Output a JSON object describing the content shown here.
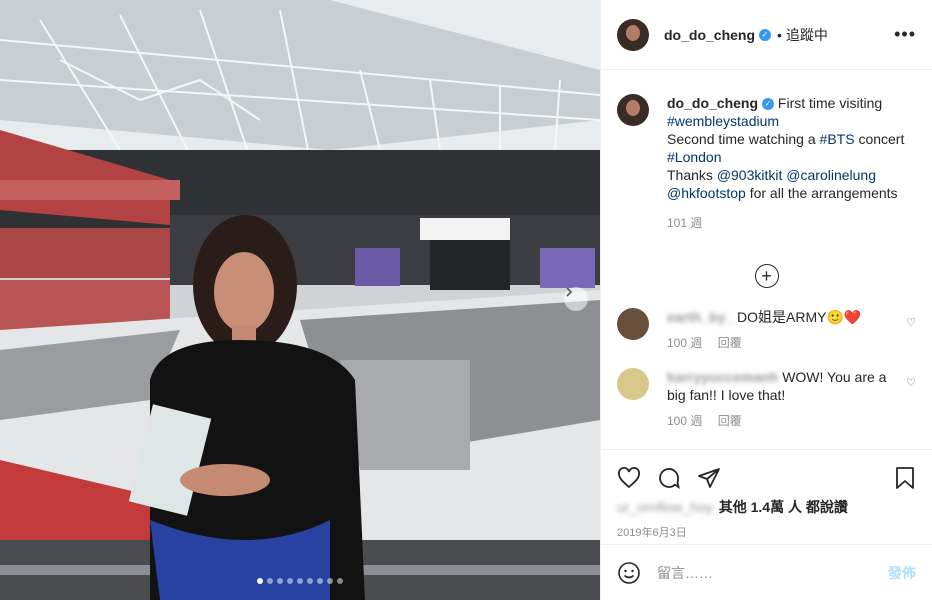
{
  "post": {
    "username": "do_do_cheng",
    "follow_separator": "•",
    "follow_label": "追蹤中",
    "more_icon": "more-options-icon"
  },
  "caption": {
    "username": "do_do_cheng",
    "line1": "First time visiting",
    "tag1": "#wembleystadium",
    "line2_pre": "Second time watching a",
    "tag2": "#BTS",
    "line2_post": "concert",
    "tag3": "#London",
    "line3_pre": "Thanks",
    "tag4": "@903kitkit",
    "tag5": "@carolinelung",
    "tag6": "@hkfootstop",
    "line4_post": "for all the arrangements",
    "age": "101 週"
  },
  "comments": [
    {
      "username": "earth_by_",
      "text": "DO姐是ARMY🙂❤️",
      "age": "100 週",
      "reply_label": "回覆",
      "avatar_color": "#6a4f3c"
    },
    {
      "username": "karryyuccemanh",
      "text": "WOW! You are a big fan!! I love that!",
      "age": "100 週",
      "reply_label": "回覆",
      "avatar_color": "#d8c98a"
    }
  ],
  "likes": {
    "liker_name": "ur_ornflow_hoy",
    "count_text": "其他 1.4萬 人 都說讚"
  },
  "date": "2019年6月3日",
  "composer": {
    "placeholder": "留言……",
    "post_label": "發佈"
  },
  "carousel": {
    "dot_count": 9,
    "active_index": 0
  },
  "colors": {
    "link": "#00376b",
    "verified": "#3897f0",
    "post_disabled": "#b2dffc",
    "meta": "#8e8e8e"
  }
}
